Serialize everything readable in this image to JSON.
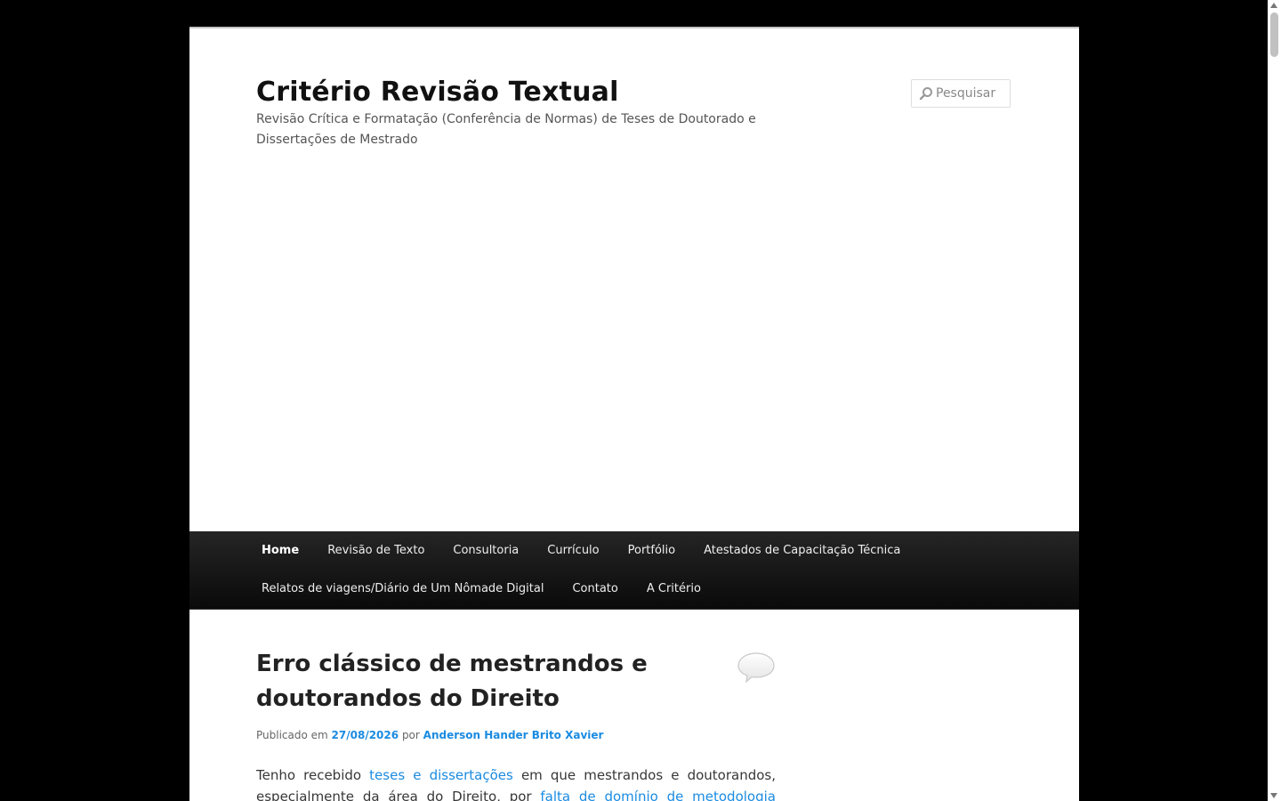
{
  "header": {
    "site_title": "Critério Revisão Textual",
    "site_description": "Revisão Crítica e Formatação (Conferência de Normas) de Teses de Doutorado e Dissertações de Mestrado",
    "search_placeholder": "Pesquisar"
  },
  "nav": {
    "row1": [
      {
        "label": "Home",
        "active": true
      },
      {
        "label": "Revisão de Texto"
      },
      {
        "label": "Consultoria"
      },
      {
        "label": "Currículo"
      },
      {
        "label": "Portfólio"
      },
      {
        "label": "Atestados de Capacitação Técnica"
      }
    ],
    "row2": [
      {
        "label": "Relatos de viagens/Diário de Um Nômade Digital"
      },
      {
        "label": "Contato"
      },
      {
        "label": "A Critério"
      }
    ]
  },
  "post": {
    "title": "Erro clássico de mestrandos e doutorandos do Direito",
    "meta_prefix": "Publicado em",
    "date": "27/08/2026",
    "meta_by": "por",
    "author": "Anderson Hander Brito Xavier",
    "body_part1": "Tenho recebido",
    "body_link1": "teses e dissertações",
    "body_part2": "em que mestrandos e doutorandos, especialmente da área do Direito, por",
    "body_link2": "falta de domínio de metodologia"
  },
  "colors": {
    "link": "#1b8be0",
    "nav_bg": "#1a1a1a",
    "page_bg": "#000000"
  }
}
